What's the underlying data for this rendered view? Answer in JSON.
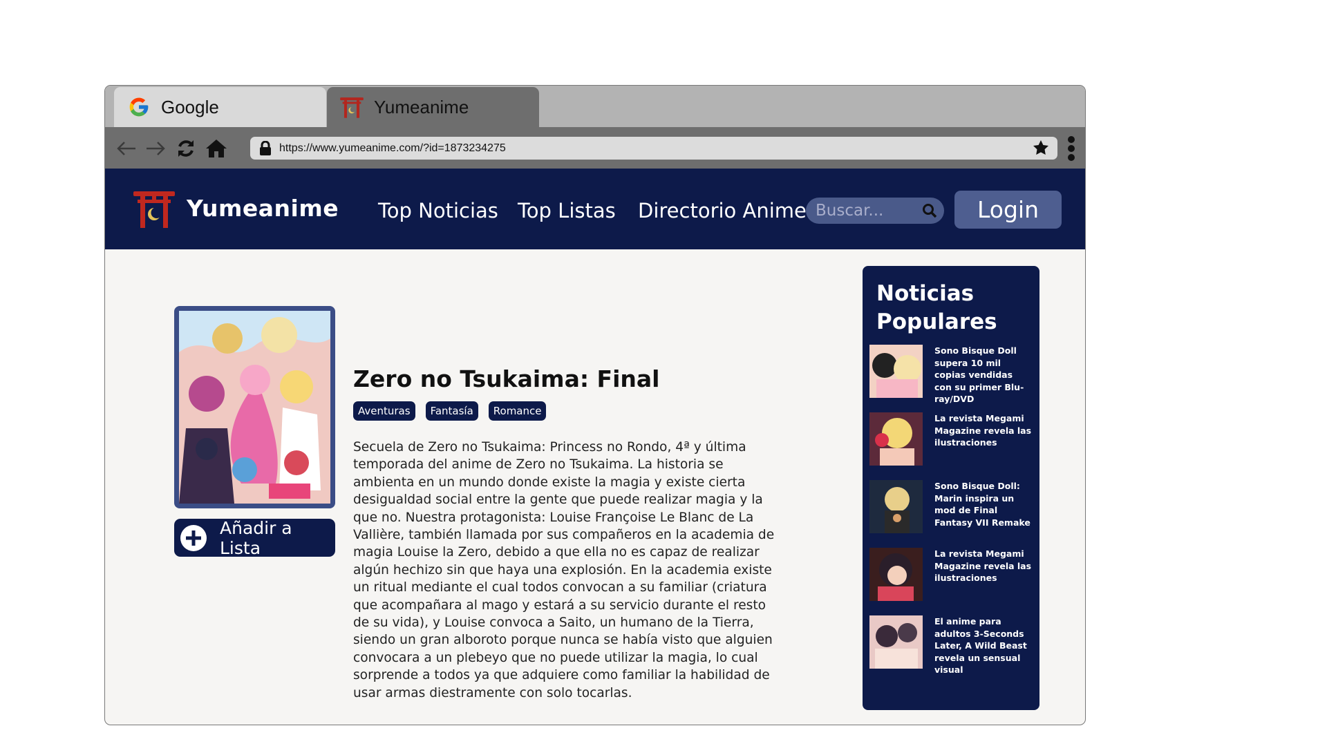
{
  "tabs": [
    {
      "label": "Google",
      "icon": "google-icon"
    },
    {
      "label": "Yumeanime",
      "icon": "torii-icon"
    }
  ],
  "toolbar": {
    "url": "https://www.yumeanime.com/?id=1873234275"
  },
  "header": {
    "brand": "Yumeanime",
    "nav": [
      "Top Noticias",
      "Top Listas",
      "Directorio Anime"
    ],
    "search_placeholder": "Buscar...",
    "login_label": "Login"
  },
  "anime": {
    "title": "Zero no Tsukaima: Final",
    "tags": [
      "Aventuras",
      "Fantasía",
      "Romance"
    ],
    "add_label": "Añadir a Lista",
    "synopsis": "Secuela de Zero no Tsukaima: Princess no Rondo, 4ª y última temporada del anime de Zero no Tsukaima. La historia se ambienta en un mundo donde existe la magia y existe cierta desigualdad social entre la gente que puede realizar magia y la que no. Nuestra protagonista: Louise Françoise Le Blanc de La Vallière, también llamada por sus compañeros en la academia de magia Louise la Zero, debido a que ella no es capaz de realizar algún hechizo sin que haya una explosión. En la academia existe un ritual mediante el cual todos convocan a su familiar (criatura que acompañara al mago y estará a su servicio durante el resto de su vida), y Louise convoca a Saito, un humano de la Tierra, siendo un gran alboroto porque nunca se había visto que alguien convocara a un plebeyo que no puede utilizar la magia, lo cual sorprende a todos ya que adquiere como familiar la habilidad de usar armas diestramente con solo tocarlas."
  },
  "sidebar": {
    "title": "Noticias Populares",
    "items": [
      {
        "text": "Sono Bisque Doll supera 10 mil copias vendidas con su primer Blu-ray/DVD"
      },
      {
        "text": "La revista Megami Magazine revela las ilustraciones"
      },
      {
        "text": "Sono Bisque Doll: Marin inspira un mod de Final Fantasy VII Remake"
      },
      {
        "text": "La revista Megami Magazine revela las ilustraciones"
      },
      {
        "text": "El anime para adultos 3-Seconds Later, A Wild Beast revela un sensual visual"
      }
    ]
  },
  "colors": {
    "navy": "#0d1a4a",
    "button_blue": "#4e5e90",
    "tab_bar": "#b3b3b3",
    "toolbar": "#6e6e6e",
    "page_bg": "#f6f5f3"
  }
}
